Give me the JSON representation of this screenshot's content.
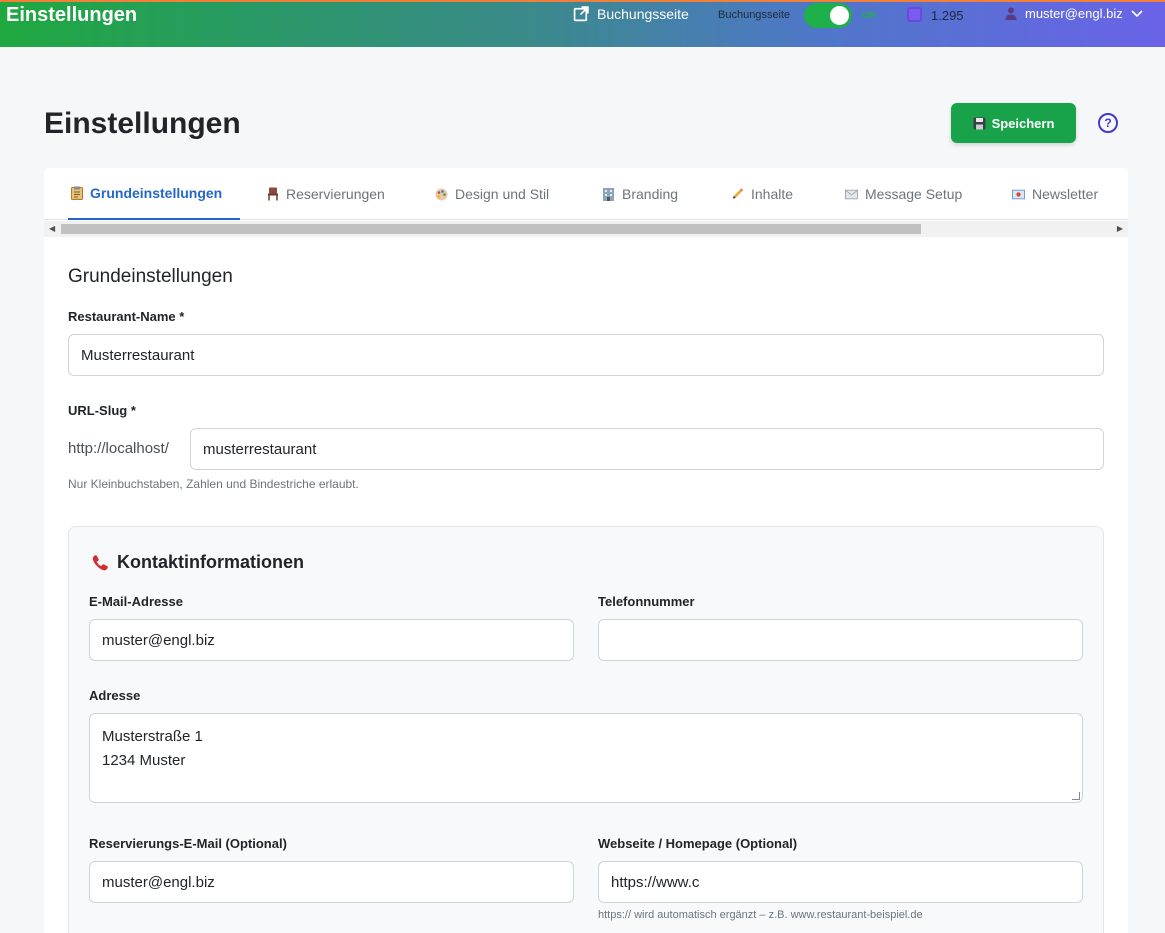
{
  "topbar": {
    "title": "Einstellungen",
    "booking_link": "Buchungsseite",
    "toggle_label": "Buchungsseite",
    "toggle_state": "ON",
    "credits": "1.295",
    "user_email": "muster@engl.biz"
  },
  "header": {
    "title": "Einstellungen",
    "save_label": "Speichern"
  },
  "tabs": [
    {
      "label": "Grundeinstellungen",
      "icon": "clipboard-icon"
    },
    {
      "label": "Reservierungen",
      "icon": "chair-icon"
    },
    {
      "label": "Design und Stil",
      "icon": "palette-icon"
    },
    {
      "label": "Branding",
      "icon": "building-icon"
    },
    {
      "label": "Inhalte",
      "icon": "pencil-icon"
    },
    {
      "label": "Message Setup",
      "icon": "envelope-icon"
    },
    {
      "label": "Newsletter",
      "icon": "mail-icon"
    }
  ],
  "form": {
    "section_title": "Grundeinstellungen",
    "restaurant_name_label": "Restaurant-Name *",
    "restaurant_name_value": "Musterrestaurant",
    "slug_label": "URL-Slug *",
    "slug_prefix": "http://localhost/",
    "slug_value": "musterrestaurant",
    "slug_hint": "Nur Kleinbuchstaben, Zahlen und Bindestriche erlaubt."
  },
  "contact": {
    "title": "Kontaktinformationen",
    "email_label": "E-Mail-Adresse",
    "email_value": "muster@engl.biz",
    "phone_label": "Telefonnummer",
    "phone_value": "",
    "address_label": "Adresse",
    "address_value": "Musterstraße 1\n1234 Muster",
    "reservation_email_label": "Reservierungs-E-Mail (Optional)",
    "reservation_email_value": "muster@engl.biz",
    "website_label": "Webseite / Homepage (Optional)",
    "website_value": "https://www.c",
    "website_hint": "https:// wird automatisch ergänzt – z.B. www.restaurant-beispiel.de"
  }
}
